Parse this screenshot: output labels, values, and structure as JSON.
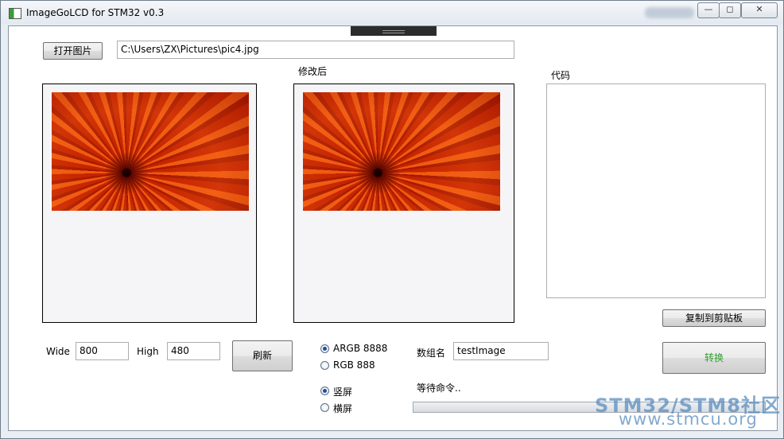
{
  "window": {
    "title": "ImageGoLCD for STM32 v0.3",
    "controls": {
      "minimize": "—",
      "maximize": "◻",
      "close": "✕"
    }
  },
  "toolbar": {
    "open_button": "打开图片",
    "file_path": "C:\\Users\\ZX\\Pictures\\pic4.jpg"
  },
  "panels": {
    "modified_label": "修改后",
    "code_label": "代码"
  },
  "size": {
    "wide_label": "Wide",
    "wide_value": "800",
    "high_label": "High",
    "high_value": "480",
    "refresh_button": "刷新"
  },
  "format": {
    "options": [
      {
        "label": "ARGB 8888",
        "checked": true
      },
      {
        "label": "RGB 888",
        "checked": false
      }
    ]
  },
  "orientation": {
    "options": [
      {
        "label": "竖屏",
        "checked": true
      },
      {
        "label": "横屏",
        "checked": false
      }
    ]
  },
  "array": {
    "name_label": "数组名",
    "name_value": "testImage",
    "status": "等待命令.."
  },
  "actions": {
    "copy_button": "复制到剪贴板",
    "convert_button": "转换",
    "convert_color": "#2e9e2e"
  },
  "progress": {
    "value": 0
  },
  "watermark": {
    "line1": "STM32/STM8社区",
    "line2": "www.stmcu.org"
  }
}
